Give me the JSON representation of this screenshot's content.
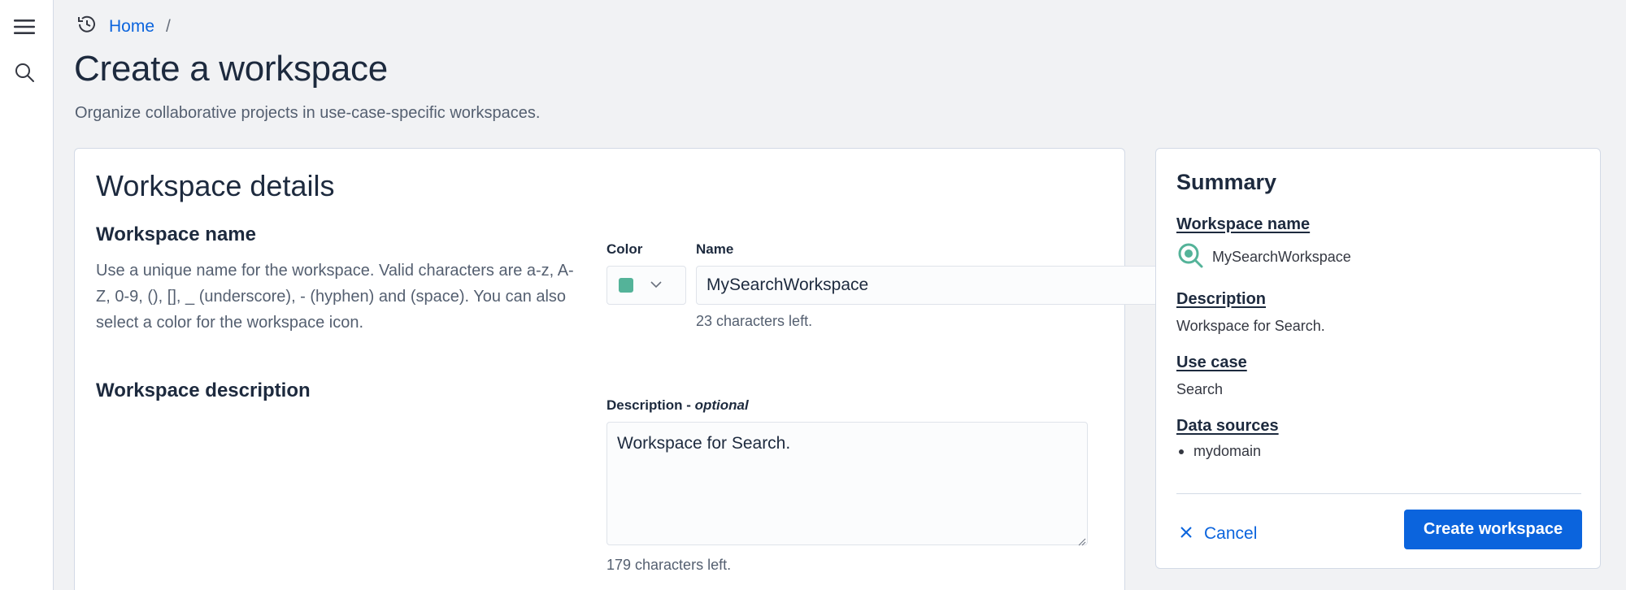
{
  "nav": {
    "menu_icon": "hamburger-menu-icon",
    "search_icon": "search-icon",
    "history_icon": "clock-history-icon"
  },
  "breadcrumbs": {
    "home": "Home",
    "separator": "/"
  },
  "page": {
    "title": "Create a workspace",
    "subtitle": "Organize collaborative projects in use-case-specific workspaces."
  },
  "details": {
    "title": "Workspace details",
    "name_section": {
      "heading": "Workspace name",
      "description": "Use a unique name for the workspace. Valid characters are a-z, A-Z, 0-9, (), [], _ (underscore), - (hyphen) and (space). You can also select a color for the workspace icon.",
      "color_label": "Color",
      "color_value": "#54b399",
      "name_label": "Name",
      "name_value": "MySearchWorkspace",
      "name_helper": "23 characters left."
    },
    "description_section": {
      "heading": "Workspace description",
      "label": "Description - ",
      "label_optional": "optional",
      "value": "Workspace for Search.",
      "helper": "179 characters left."
    }
  },
  "summary": {
    "title": "Summary",
    "workspace_name_heading": "Workspace name",
    "workspace_name_value": "MySearchWorkspace",
    "workspace_icon": "search-workspace-icon",
    "description_heading": "Description",
    "description_value": "Workspace for Search.",
    "use_case_heading": "Use case",
    "use_case_value": "Search",
    "data_sources_heading": "Data sources",
    "data_sources": [
      "mydomain"
    ],
    "cancel_label": "Cancel",
    "create_label": "Create workspace"
  },
  "colors": {
    "accent": "#0b64dd",
    "workspace_color": "#54b399"
  }
}
